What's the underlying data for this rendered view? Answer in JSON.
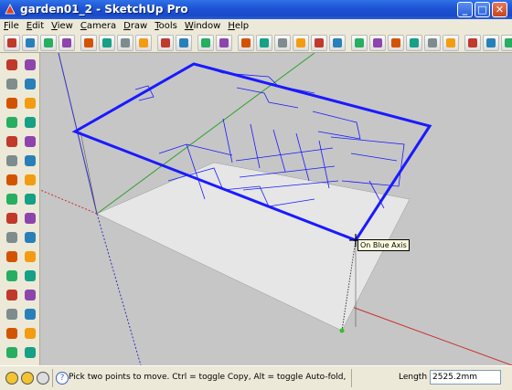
{
  "window": {
    "title": "garden01_2 - SketchUp Pro"
  },
  "menu": [
    "File",
    "Edit",
    "View",
    "Camera",
    "Draw",
    "Tools",
    "Window",
    "Help"
  ],
  "toolbar_icons": [
    "select-icon",
    "make-component-icon",
    "save-icon",
    "cut-icon",
    "copy-icon",
    "paste-icon",
    "erase-icon",
    "undo-icon",
    "redo-icon",
    "print-icon",
    "model-info-icon",
    "iso-view-icon",
    "top-view-icon",
    "front-view-icon",
    "right-view-icon",
    "back-view-icon",
    "left-view-icon",
    "xray-icon",
    "wireframe-icon",
    "hidden-line-icon",
    "shaded-icon",
    "shaded-texture-icon",
    "monochrome-icon",
    "warehouse-icon",
    "components-icon",
    "share-icon",
    "extension-icon"
  ],
  "left_tools": [
    "select-tool",
    "component-tool",
    "paint-bucket-tool",
    "eraser-tool",
    "rectangle-tool",
    "line-tool",
    "circle-tool",
    "arc-tool",
    "polygon-tool",
    "freehand-tool",
    "move-tool",
    "push-pull-tool",
    "rotate-tool",
    "follow-me-tool",
    "scale-tool",
    "offset-tool",
    "tape-measure-tool",
    "dimension-tool",
    "protractor-tool",
    "text-tool",
    "axes-tool",
    "3d-text-tool",
    "orbit-tool",
    "pan-tool",
    "zoom-tool",
    "zoom-window-tool",
    "zoom-extents-tool",
    "previous-view-tool",
    "position-camera-tool",
    "look-around-tool",
    "walk-tool",
    "section-plane-tool"
  ],
  "viewport": {
    "tooltip": "On Blue Axis"
  },
  "status": {
    "message": "Pick two points to move.  Ctrl = toggle Copy, Alt = toggle Auto-fold, hold Shift = lock infer",
    "length_label": "Length",
    "length_value": "2525.2mm"
  },
  "colors": {
    "selection": "#1a1aff",
    "red_axis": "#c83030",
    "green_axis": "#30a030",
    "blue_axis": "#3030c0",
    "ground": "#c8c8c8",
    "face": "#e8e8e8"
  }
}
